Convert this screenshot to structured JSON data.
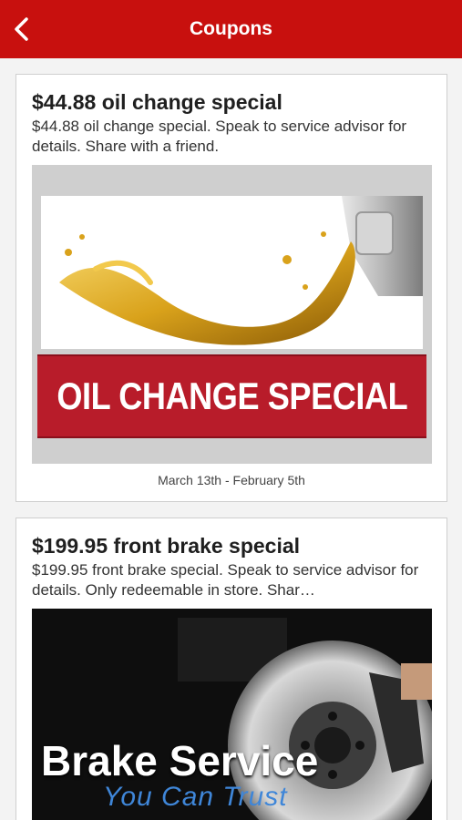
{
  "header": {
    "title": "Coupons",
    "back_icon": "chevron-left-icon",
    "bg_color": "#c8100e"
  },
  "coupons": [
    {
      "title": "$44.88 oil change special",
      "description": "$44.88 oil change special. Speak to service advisor for details. Share with a friend.",
      "image_text": "OIL CHANGE SPECIAL",
      "dates": "March 13th - February 5th"
    },
    {
      "title": "$199.95 front brake special",
      "description": "$199.95 front brake special. Speak to service advisor for details. Only redeemable in store. Shar…",
      "image_text_main": "Brake Service",
      "image_text_sub": "You Can Trust"
    }
  ]
}
